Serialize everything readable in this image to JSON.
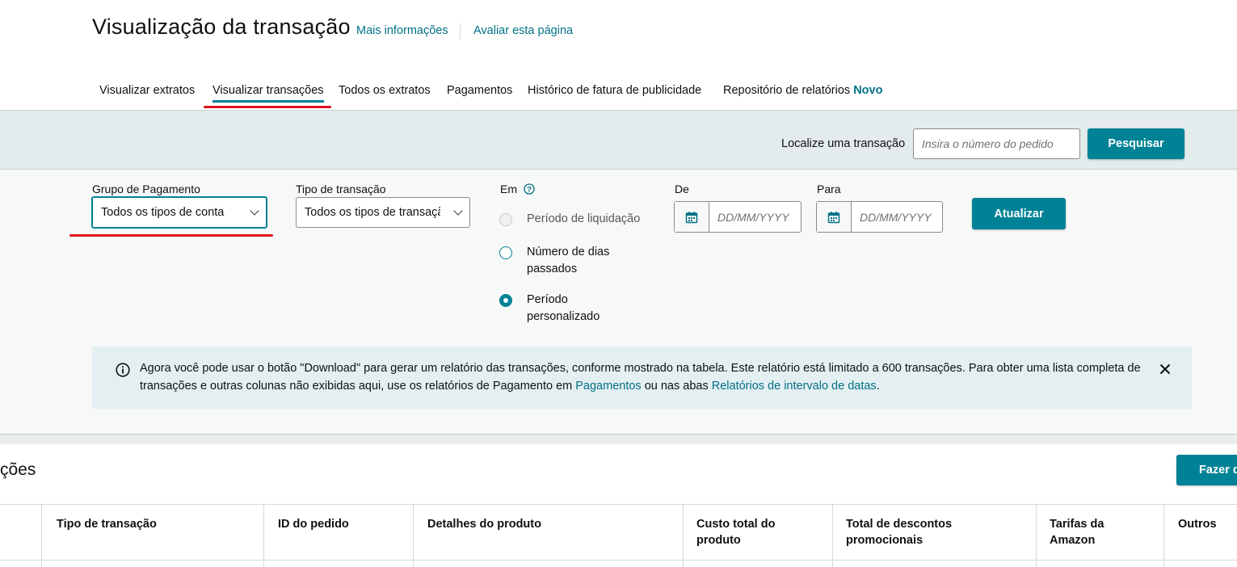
{
  "header": {
    "title": "Visualização da transação",
    "more_info": "Mais informações",
    "rate_page": "Avaliar esta página"
  },
  "tabs": [
    {
      "label": "Visualizar extratos"
    },
    {
      "label": "Visualizar transações",
      "active": true
    },
    {
      "label": "Todos os extratos"
    },
    {
      "label": "Pagamentos"
    },
    {
      "label": "Histórico de fatura de publicidade"
    },
    {
      "label": "Repositório de relatórios",
      "badge": "Novo"
    }
  ],
  "search": {
    "label": "Localize uma transação",
    "placeholder": "Insira o número do pedido",
    "button": "Pesquisar"
  },
  "filters": {
    "payment_group": {
      "label": "Grupo de Pagamento",
      "value": "Todos os tipos de conta"
    },
    "transaction_type": {
      "label": "Tipo de transação",
      "value": "Todos os tipos de transação"
    },
    "in": {
      "label": "Em",
      "options": [
        {
          "label": "Período de liquidação",
          "state": "disabled"
        },
        {
          "label_line1": "Número de dias",
          "label_line2": "passados",
          "state": "unchecked"
        },
        {
          "label_line1": "Período",
          "label_line2": "personalizado",
          "state": "checked"
        }
      ]
    },
    "from": {
      "label": "De",
      "placeholder": "DD/MM/YYYY"
    },
    "to": {
      "label": "Para",
      "placeholder": "DD/MM/YYYY"
    },
    "update_button": "Atualizar"
  },
  "notice": {
    "text_1": "Agora você pode usar o botão \"Download\" para gerar um relatório das transações, conforme mostrado na tabela. Este relatório está limitado a 600 transações. Para obter uma lista completa de transações e outras colunas não exibidas aqui, use os relatórios de Pagamento em ",
    "link_1": "Pagamentos",
    "text_2": " ou nas abas ",
    "link_2": "Relatórios de intervalo de datas",
    "text_3": "."
  },
  "results": {
    "title": "ções",
    "download_button": "Fazer d",
    "columns": [
      {
        "line1": "Tipo de transação",
        "line2": ""
      },
      {
        "line1": "ID do pedido",
        "line2": ""
      },
      {
        "line1": "Detalhes do produto",
        "line2": ""
      },
      {
        "line1": "Custo total do",
        "line2": "produto"
      },
      {
        "line1": "Total de descontos",
        "line2": "promocionais"
      },
      {
        "line1": "Tarifas da",
        "line2": "Amazon"
      },
      {
        "line1": "Outros",
        "line2": ""
      }
    ]
  },
  "colors": {
    "accent": "#008296",
    "link": "#007185",
    "annotation": "#e0141e"
  }
}
